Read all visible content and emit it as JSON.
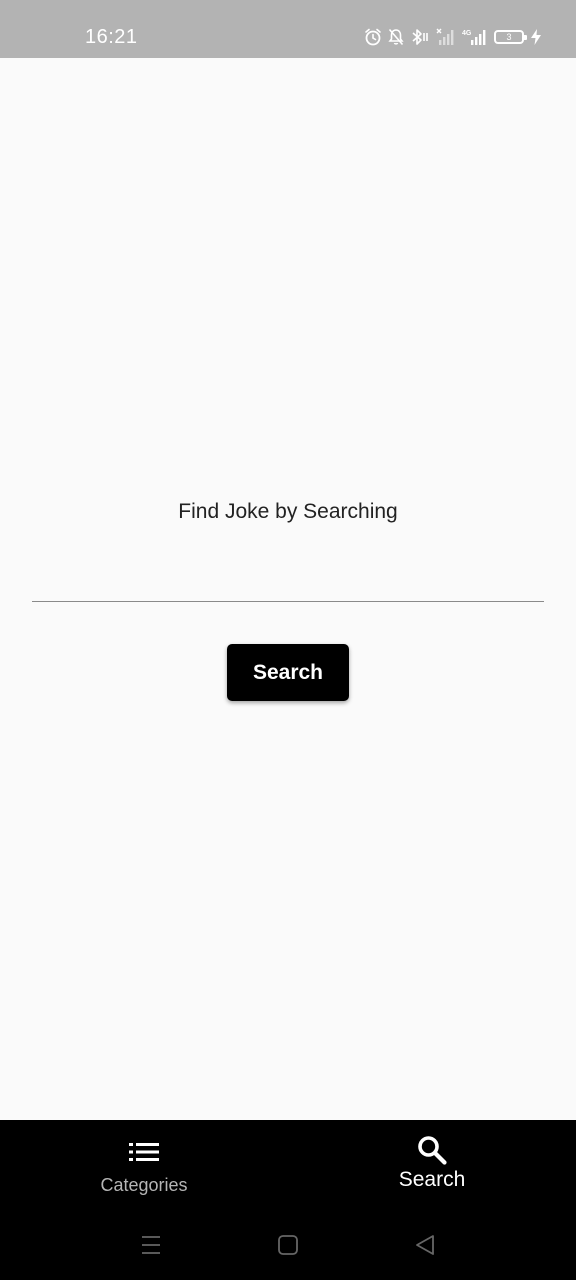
{
  "status_bar": {
    "time": "16:21",
    "battery_level": "3",
    "icons": [
      "alarm-icon",
      "bell-off-icon",
      "bluetooth-icon",
      "signal-off-icon",
      "signal-4g-icon",
      "battery-icon",
      "charging-icon"
    ],
    "network_label": "4G"
  },
  "main": {
    "prompt": "Find Joke by Searching",
    "search_input": {
      "value": "",
      "placeholder": ""
    },
    "search_button_label": "Search"
  },
  "bottom_nav": {
    "items": [
      {
        "label": "Categories",
        "icon": "list-icon",
        "active": false
      },
      {
        "label": "Search",
        "icon": "search-icon",
        "active": true
      }
    ]
  },
  "system_nav": {
    "buttons": [
      "menu-icon",
      "home-icon",
      "back-icon"
    ]
  },
  "colors": {
    "status_bar_bg": "#b3b3b3",
    "page_bg": "#fafafa",
    "nav_bg": "#000000",
    "button_bg": "#000000",
    "button_text": "#ffffff",
    "inactive_nav": "#b5b5b5",
    "active_nav": "#ffffff"
  }
}
